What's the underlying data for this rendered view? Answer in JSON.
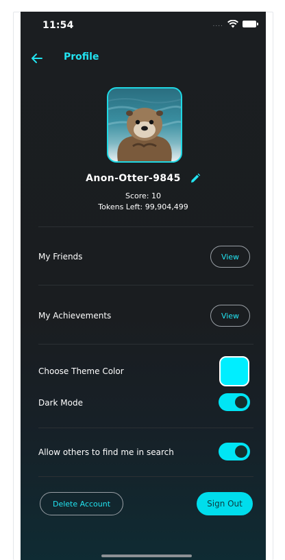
{
  "status_bar": {
    "time": "11:54",
    "signal": "....",
    "wifi_icon": "wifi-icon",
    "battery_icon": "battery-icon"
  },
  "header": {
    "title": "Profile",
    "back_icon": "arrow-left-icon"
  },
  "profile": {
    "username": "Anon-Otter-9845",
    "edit_icon": "pencil-icon",
    "score_label": "Score:",
    "score_value": "10",
    "tokens_label": "Tokens Left:",
    "tokens_value": "99,904,499"
  },
  "rows": {
    "friends_label": "My Friends",
    "friends_button": "View",
    "achievements_label": "My Achievements",
    "achievements_button": "View",
    "theme_label": "Choose Theme Color",
    "theme_color": "#00eeff",
    "dark_mode_label": "Dark Mode",
    "dark_mode_on": true,
    "search_label": "Allow others to find me in search",
    "search_on": true
  },
  "actions": {
    "delete_label": "Delete Account",
    "signout_label": "Sign Out"
  },
  "colors": {
    "accent": "#22e3f0",
    "background": "#1b1e21",
    "toggle_on": "#00e5f5"
  }
}
